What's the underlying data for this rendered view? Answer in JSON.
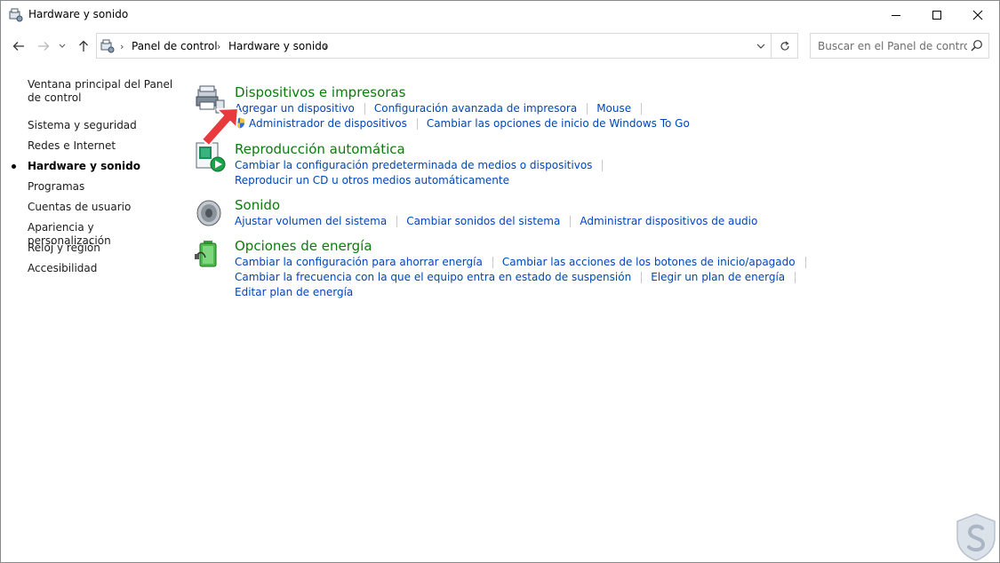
{
  "window": {
    "title": "Hardware y sonido",
    "controls": {
      "minimize": "minimize-icon",
      "maximize": "maximize-icon",
      "close": "close-icon"
    }
  },
  "address": {
    "breadcrumbs": [
      "Panel de control",
      "Hardware y sonido"
    ],
    "search_placeholder": "Buscar en el Panel de control"
  },
  "sidebar": {
    "items": [
      {
        "label": "Ventana principal del Panel de control",
        "active": false
      },
      {
        "label": "Sistema y seguridad",
        "active": false
      },
      {
        "label": "Redes e Internet",
        "active": false
      },
      {
        "label": "Hardware y sonido",
        "active": true
      },
      {
        "label": "Programas",
        "active": false
      },
      {
        "label": "Cuentas de usuario",
        "active": false
      },
      {
        "label": "Apariencia y personalización",
        "active": false
      },
      {
        "label": "Reloj y región",
        "active": false
      },
      {
        "label": "Accesibilidad",
        "active": false
      }
    ]
  },
  "sections": [
    {
      "title": "Dispositivos e impresoras",
      "icon": "printer-icon",
      "links": [
        [
          "Agregar un dispositivo",
          "Configuración avanzada de impresora",
          "Mouse"
        ],
        [
          "Administrador de dispositivos",
          "Cambiar las opciones de inicio de Windows To Go"
        ]
      ]
    },
    {
      "title": "Reproducción automática",
      "icon": "autoplay-icon",
      "links": [
        [
          "Cambiar la configuración predeterminada de medios o dispositivos"
        ],
        [
          "Reproducir un CD u otros medios automáticamente"
        ]
      ]
    },
    {
      "title": "Sonido",
      "icon": "speaker-icon",
      "links": [
        [
          "Ajustar volumen del sistema",
          "Cambiar sonidos del sistema",
          "Administrar dispositivos de audio"
        ]
      ]
    },
    {
      "title": "Opciones de energía",
      "icon": "battery-icon",
      "links": [
        [
          "Cambiar la configuración para ahorrar energía",
          "Cambiar las acciones de los botones de inicio/apagado"
        ],
        [
          "Cambiar la frecuencia con la que el equipo entra en estado de suspensión",
          "Elegir un plan de energía"
        ],
        [
          "Editar plan de energía"
        ]
      ]
    }
  ],
  "colors": {
    "heading": "#0b7c0b",
    "link": "#0046b8",
    "annotation_arrow": "#e8393c"
  }
}
